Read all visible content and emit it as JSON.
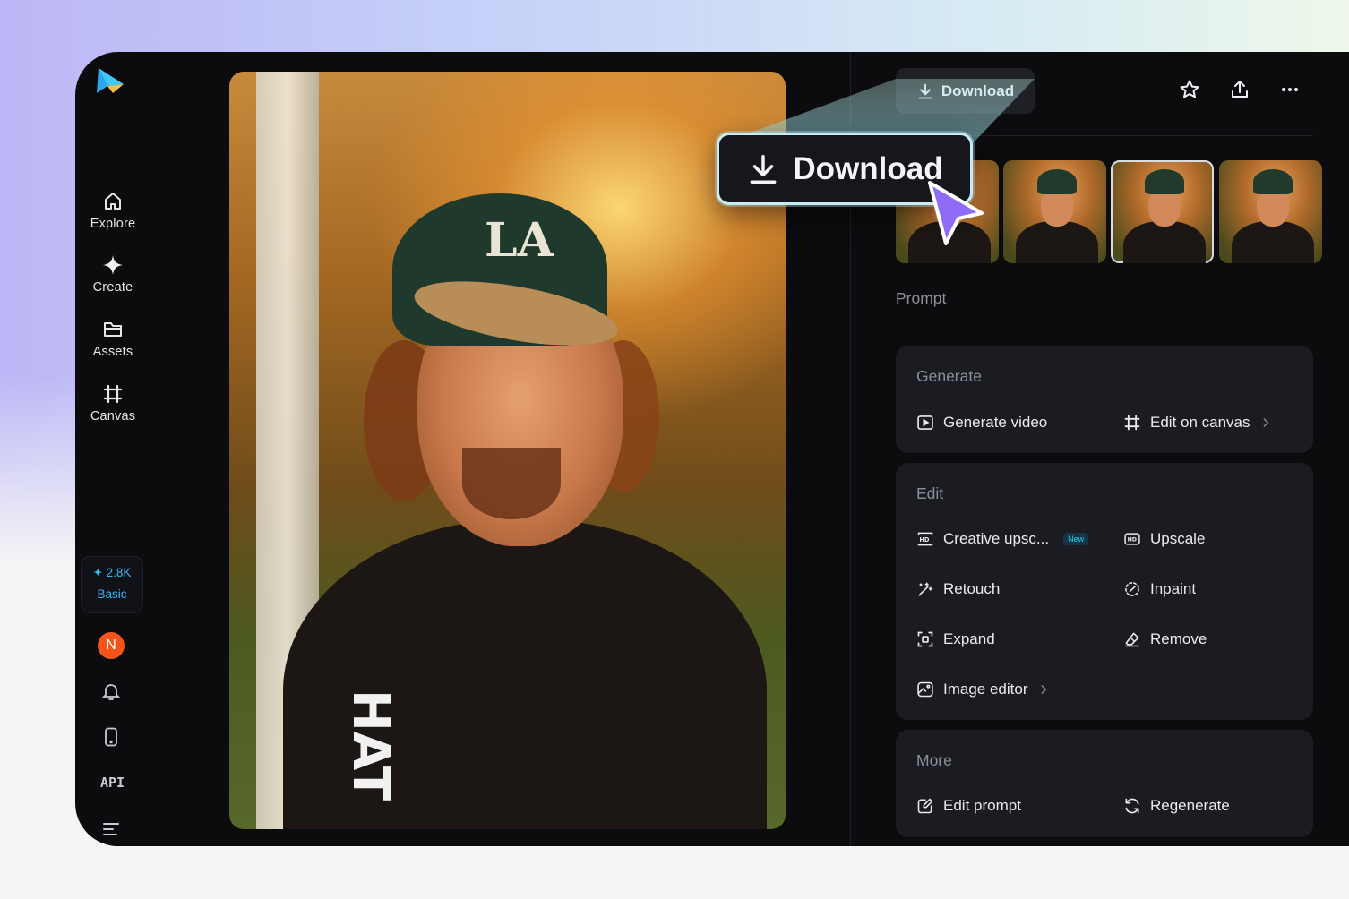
{
  "sidebar": {
    "items": [
      {
        "label": "Explore",
        "icon": "home-icon"
      },
      {
        "label": "Create",
        "icon": "sparkle-icon"
      },
      {
        "label": "Assets",
        "icon": "folder-icon"
      },
      {
        "label": "Canvas",
        "icon": "canvas-icon"
      }
    ],
    "credits": {
      "amount": "2.8K",
      "plan": "Basic"
    },
    "avatar_initial": "N",
    "api_label": "API"
  },
  "header": {
    "download_label": "Download",
    "icons": [
      "star-icon",
      "share-icon",
      "more-icon"
    ]
  },
  "callout": {
    "download_label": "Download"
  },
  "thumbnails": {
    "count": 4,
    "selected_index": 2
  },
  "prompt_label": "Prompt",
  "generate": {
    "title": "Generate",
    "generate_video": "Generate video",
    "edit_on_canvas": "Edit on canvas"
  },
  "edit": {
    "title": "Edit",
    "creative_upscale": "Creative upsc...",
    "new_badge": "New",
    "upscale": "Upscale",
    "retouch": "Retouch",
    "inpaint": "Inpaint",
    "expand": "Expand",
    "remove": "Remove",
    "image_editor": "Image editor"
  },
  "more": {
    "title": "More",
    "edit_prompt": "Edit prompt",
    "regenerate": "Regenerate"
  },
  "photo": {
    "cap_logo": "LA",
    "sleeve_text": "HAT"
  },
  "colors": {
    "accent": "#3fb6f3",
    "avatar": "#f2541b",
    "panel": "#1b1c21",
    "background": "#0c0c0e"
  }
}
